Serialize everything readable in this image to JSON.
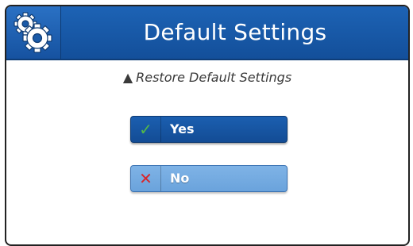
{
  "header": {
    "title": "Default Settings",
    "icon": "gears-icon"
  },
  "notice": {
    "text": "Restore Default Settings",
    "icon": "warning-icon"
  },
  "buttons": {
    "yes_label": "Yes",
    "no_label": "No",
    "yes_icon": "checkmark-icon",
    "no_icon": "x-icon"
  },
  "colors": {
    "header_bg": "#1d63b5",
    "yes_bg": "#1b5fb0",
    "no_bg": "#7fb3e6",
    "check_green": "#54b948",
    "x_red": "#d8262b"
  }
}
